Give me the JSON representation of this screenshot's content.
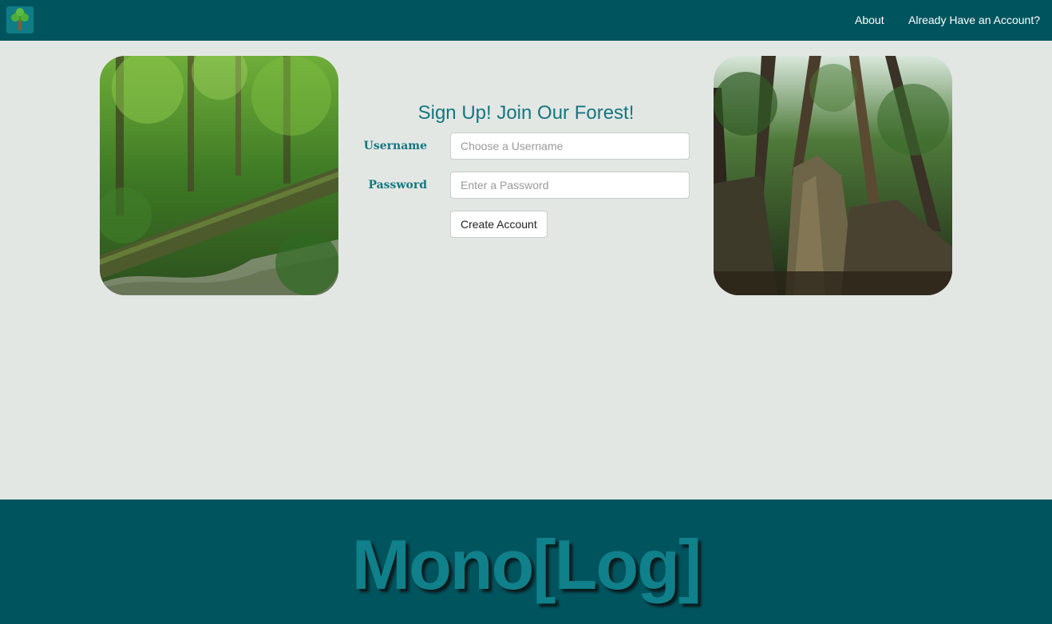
{
  "navbar": {
    "logo_icon": "tree-icon",
    "links": [
      {
        "label": "About"
      },
      {
        "label": "Already Have an Account?"
      }
    ]
  },
  "images": {
    "left": "forest-stream-photo",
    "right": "tall-trees-photo"
  },
  "form": {
    "title": "Sign Up! Join Our Forest!",
    "username": {
      "label": "Username",
      "placeholder": "Choose a Username",
      "value": ""
    },
    "password": {
      "label": "Password",
      "placeholder": "Enter a Password",
      "value": ""
    },
    "submit_label": "Create Account"
  },
  "footer": {
    "brand": "Mono[Log]"
  },
  "colors": {
    "nav_background": "#00545e",
    "page_background": "#e3e7e4",
    "accent_text": "#13777f",
    "footer_brand": "#10808a"
  }
}
